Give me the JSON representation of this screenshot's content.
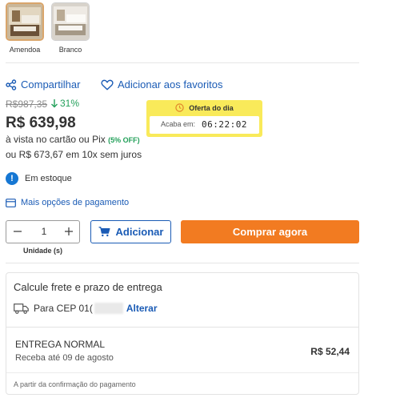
{
  "variants": [
    {
      "label": "Amendoa",
      "selected": true
    },
    {
      "label": "Branco",
      "selected": false
    }
  ],
  "actions": {
    "share": "Compartilhar",
    "favorite": "Adicionar aos favoritos"
  },
  "price": {
    "old": "R$987,35",
    "discount": "31%",
    "current": "R$ 639,98",
    "cash_note": "à vista no cartão ou Pix",
    "cash_off": "(5% OFF)",
    "installments": "ou R$ 673,67 em 10x sem juros"
  },
  "deal": {
    "title": "Oferta do dia",
    "ends_label": "Acaba em:",
    "timer": "06:22:02"
  },
  "stock": {
    "status": "Em estoque"
  },
  "payment_link": "Mais opções de pagamento",
  "quantity": {
    "value": "1",
    "unit": "Unidade (s)"
  },
  "buttons": {
    "add": "Adicionar",
    "buy_now": "Comprar agora"
  },
  "shipping": {
    "title": "Calcule frete e prazo de entrega",
    "cep_label": "Para CEP 01(",
    "change": "Alterar",
    "method": "ENTREGA NORMAL",
    "eta": "Receba até 09 de agosto",
    "cost": "R$ 52,44",
    "note": "A partir da confirmação do pagamento"
  },
  "colors": {
    "accent_blue": "#1a5bb5",
    "buy_orange": "#f27b21",
    "deal_yellow": "#f9ea5a",
    "discount_green": "#23a05a"
  }
}
